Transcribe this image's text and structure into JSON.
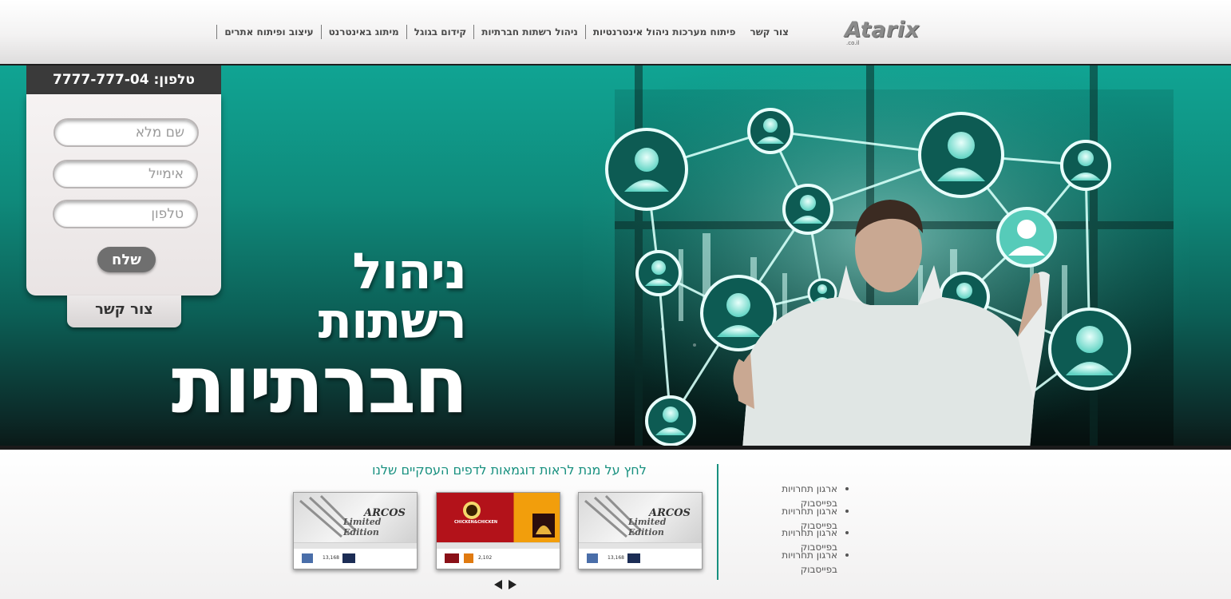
{
  "header": {
    "logo_text": "Atarix",
    "logo_sub": ".co.il",
    "nav": [
      "עיצוב ופיתוח אתרים",
      "מיתוג באינטרנט",
      "קידום בגוגל",
      "ניהול רשתות חברתיות",
      "פיתוח מערכות ניהול אינטרנטיות",
      "צור קשר"
    ]
  },
  "hero": {
    "headline_line1": "ניהול",
    "headline_line2": "רשתות",
    "headline_line3": "חברתיות"
  },
  "contact_form": {
    "phone_label": "טלפון: 7777-777-04",
    "name_placeholder": "שם מלא",
    "email_placeholder": "אימייל",
    "phone_placeholder": "טלפון",
    "send_label": "שלח",
    "contact_tab_label": "צור קשר"
  },
  "bottom": {
    "heading": "לחץ על מנת לראות דוגמאות לדפים העסקיים שלנו",
    "bullets": [
      "ארגון תחרויות בפייסבוק",
      "ארגון תחרויות בפייסבוק",
      "ארגון תחרויות בפייסבוק",
      "ארגון תחרויות בפייסבוק"
    ],
    "thumbnails": [
      {
        "brand": "ARCOS",
        "tagline": "Limited Edition",
        "count": "13,168"
      },
      {
        "brand": "CHICKEN&CHICKEN",
        "count": "2,102"
      },
      {
        "brand": "ARCOS",
        "tagline": "Limited Edition",
        "count": "13,168"
      }
    ]
  },
  "colors": {
    "accent_teal": "#17907f",
    "hero_top": "#10a493",
    "hero_bottom": "#0a1816",
    "nav_text": "#4a4a4a"
  }
}
